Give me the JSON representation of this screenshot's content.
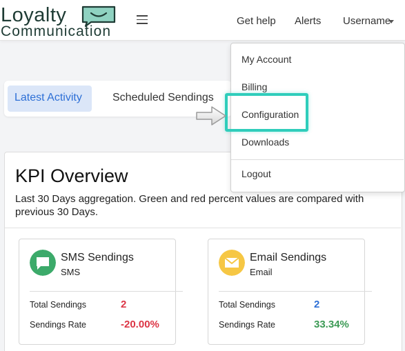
{
  "brand": {
    "line1": "Loyalty",
    "line2": "Communication"
  },
  "header": {
    "help": "Get help",
    "alerts": "Alerts",
    "username": "Username"
  },
  "tabs": {
    "latest": "Latest Activity",
    "scheduled": "Scheduled Sendings"
  },
  "dropdown": {
    "items": [
      "My Account",
      "Billing",
      "Configuration",
      "Downloads",
      "Logout"
    ],
    "highlighted": "Configuration"
  },
  "kpi": {
    "title": "KPI Overview",
    "description": "Last 30 Days aggregation. Green and red percent values are compared with previous 30 Days."
  },
  "cards": [
    {
      "title": "SMS Sendings",
      "subtitle": "SMS",
      "icon": "chat-bubble-icon",
      "icon_color": "#3caa6a",
      "total_label": "Total Sendings",
      "total_value": "2",
      "total_color": "#dc3545",
      "rate_label": "Sendings Rate",
      "rate_value": "-20.00%",
      "rate_color": "#dc3545"
    },
    {
      "title": "Email Sendings",
      "subtitle": "Email",
      "icon": "envelope-icon",
      "icon_color": "#f6c744",
      "total_label": "Total Sendings",
      "total_value": "2",
      "total_color": "#2d6fd6",
      "rate_label": "Sendings Rate",
      "rate_value": "33.34%",
      "rate_color": "#3c9a55"
    }
  ],
  "colors": {
    "accent": "#2d6fd6",
    "highlight": "#2fcdbb"
  }
}
